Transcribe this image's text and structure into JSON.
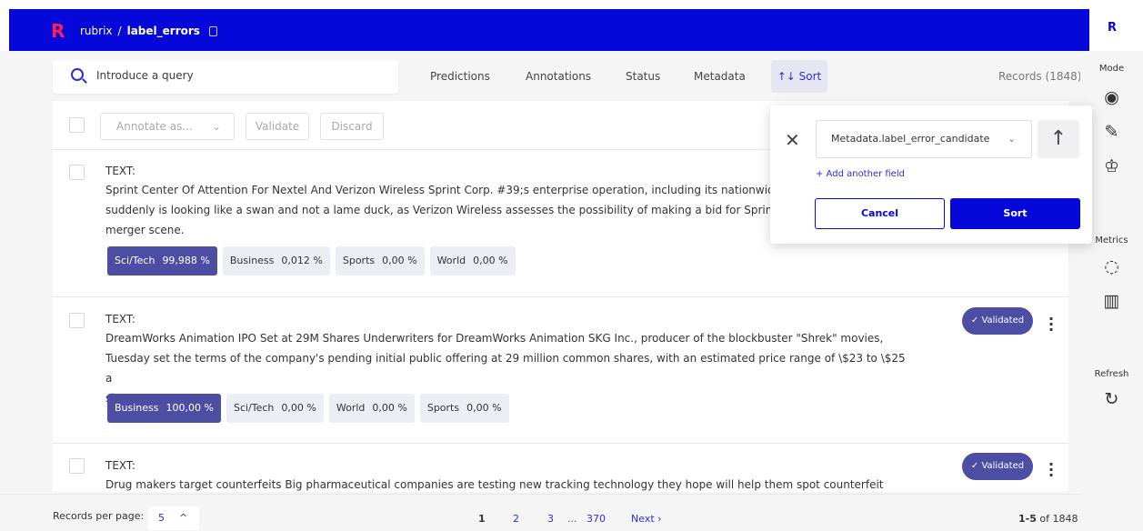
{
  "header": {
    "project": "rubrix",
    "separator": "/",
    "dataset": "label_errors",
    "avatar": "R",
    "colors": {
      "bar": "#0508d9",
      "logo": "#ff1e5a",
      "accent": "#4c4ea3"
    }
  },
  "search": {
    "placeholder": "Introduce a query"
  },
  "filters": {
    "predictions": "Predictions",
    "annotations": "Annotations",
    "status": "Status",
    "metadata": "Metadata",
    "sort": "↑↓ Sort",
    "records": "Records (1848)"
  },
  "toolbar": {
    "annotate": "Annotate as...",
    "validate": "Validate",
    "discard": "Discard"
  },
  "sidebar": {
    "mode": "Mode",
    "metrics": "Metrics",
    "refresh": "Refresh",
    "icons": [
      "eye-icon",
      "pencil-icon",
      "hierarchy-icon",
      "progress-ring-icon",
      "bar-chart-icon",
      "refresh-icon"
    ]
  },
  "records": [
    {
      "label": "TEXT:",
      "text": "Sprint Center Of Attention For Nextel And Verizon Wireless Sprint Corp. #39;s enterprise operation, including its nationwide fibe",
      "text2": "suddenly is looking like a swan and not a lame duck, as Verizon Wireless assesses the possibility of making a bid for Sprint in th",
      "text3": "merger scene.",
      "chips": [
        {
          "label": "Sci/Tech",
          "score": "99,988 %"
        },
        {
          "label": "Business",
          "score": "0,012 %"
        },
        {
          "label": "Sports",
          "score": "0,00 %"
        },
        {
          "label": "World",
          "score": "0,00 %"
        }
      ]
    },
    {
      "label": "TEXT:",
      "text": "DreamWorks Animation IPO Set at 29M Shares Underwriters for DreamWorks Animation SKG Inc., producer of the blockbuster \"Shrek\" movies,",
      "text2": "Tuesday set the terms of the company's pending initial public offering at 29 million common shares, with an estimated price range of \\$23 to \\$25 a",
      "text3": "share.",
      "status": "✓ Validated",
      "chips": [
        {
          "label": "Business",
          "score": "100,00 %"
        },
        {
          "label": "Sci/Tech",
          "score": "0,00 %"
        },
        {
          "label": "World",
          "score": "0,00 %"
        },
        {
          "label": "Sports",
          "score": "0,00 %"
        }
      ]
    },
    {
      "label": "TEXT:",
      "text": "Drug makers target counterfeits Big pharmaceutical companies are testing new tracking technology they hope will help them spot counterfeit drugs",
      "status": "✓ Validated"
    }
  ],
  "footer": {
    "per_page_label": "Records per page:",
    "per_page": "5",
    "pages": [
      "1",
      "2",
      "3",
      "...",
      "370"
    ],
    "next": "Next ›",
    "range_bold": "1-5",
    "range_rest": "of 1848"
  },
  "popover": {
    "field": "Metadata.label_error_candidate",
    "add": "+ Add another field",
    "cancel": "Cancel",
    "sort": "Sort"
  }
}
